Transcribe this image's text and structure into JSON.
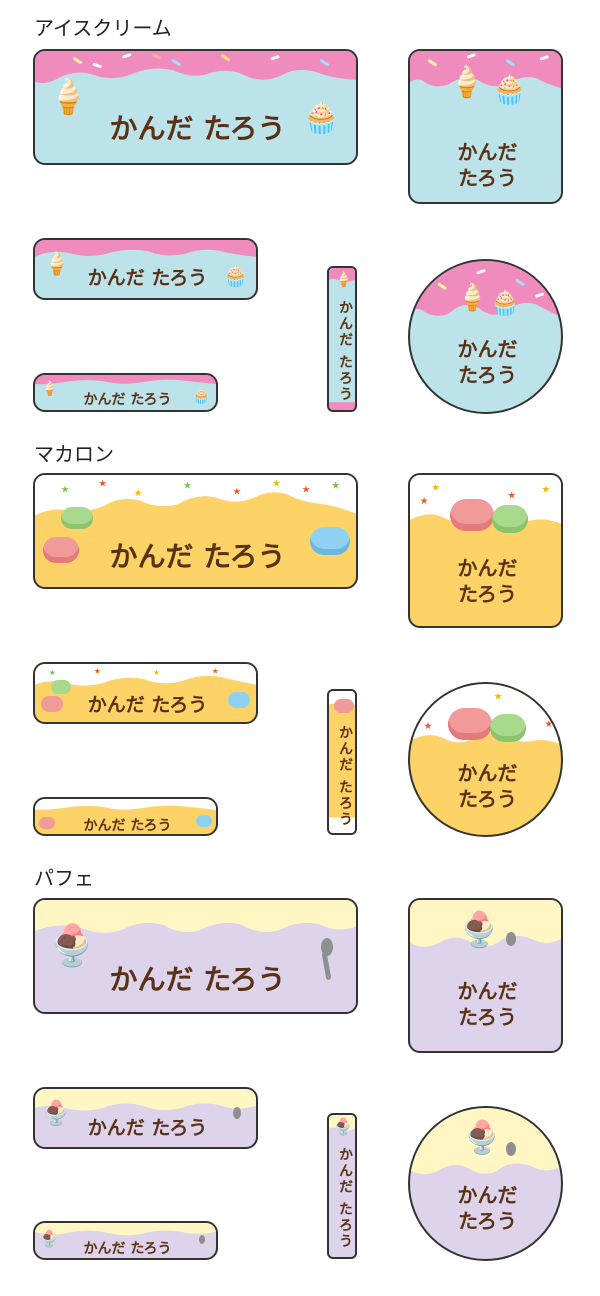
{
  "sections": [
    {
      "title": "アイスクリーム"
    },
    {
      "title": "マカロン"
    },
    {
      "title": "パフェ"
    }
  ],
  "label_name": "かんだ たろう",
  "label_name_line1": "かんだ",
  "label_name_line2": "たろう",
  "colors": {
    "ice_top": "#f08cbd",
    "ice_body": "#bde3ea",
    "macaron_top": "#ffffff",
    "macaron_body": "#fdd266",
    "parfait_top": "#fff6c4",
    "parfait_body": "#ddd3ea",
    "text": "#5a3115",
    "border": "#333333"
  },
  "icons": {
    "ice": [
      "ice-cream-cone-icon",
      "cupcake-icon"
    ],
    "macaron": [
      "macaron-icon",
      "star-icon"
    ],
    "parfait": [
      "parfait-glass-icon",
      "spoon-icon"
    ]
  }
}
